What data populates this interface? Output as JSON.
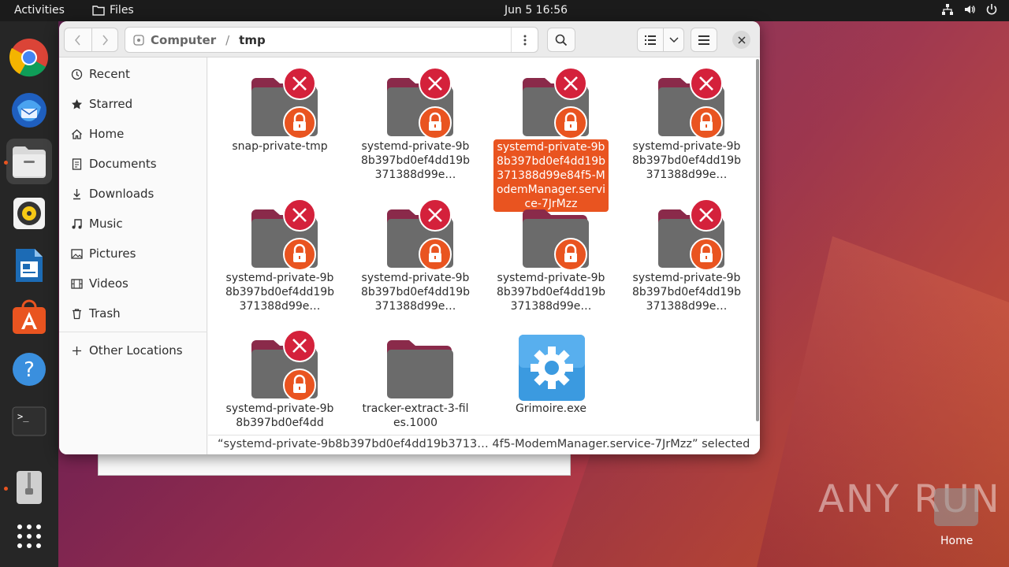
{
  "topbar": {
    "activities": "Activities",
    "app_name": "Files",
    "clock": "Jun 5  16:56"
  },
  "dock": {
    "items": [
      "chrome-icon",
      "thunderbird-icon",
      "files-icon",
      "rhythmbox-icon",
      "libreoffice-writer-icon",
      "app-center-icon",
      "help-icon",
      "terminal-icon",
      "archive-manager-icon",
      "show-apps-icon"
    ]
  },
  "window": {
    "path": {
      "root": "Computer",
      "current": "tmp"
    },
    "sidebar": {
      "items": [
        {
          "label": "Recent",
          "icon": "clock-icon"
        },
        {
          "label": "Starred",
          "icon": "star-icon"
        },
        {
          "label": "Home",
          "icon": "home-icon"
        },
        {
          "label": "Documents",
          "icon": "document-icon"
        },
        {
          "label": "Downloads",
          "icon": "download-icon"
        },
        {
          "label": "Music",
          "icon": "music-icon"
        },
        {
          "label": "Pictures",
          "icon": "picture-icon"
        },
        {
          "label": "Videos",
          "icon": "video-icon"
        },
        {
          "label": "Trash",
          "icon": "trash-icon"
        }
      ],
      "other": "Other Locations"
    },
    "files": [
      {
        "name": "snap-private-tmp",
        "type": "locked-folder"
      },
      {
        "name": "systemd-private-9b8b397bd0ef4dd19b371388d99e…",
        "type": "locked-folder"
      },
      {
        "name": "systemd-private-9b8b397bd0ef4dd19b371388d99e84f5-ModemManager.service-7JrMzz",
        "type": "locked-folder",
        "selected": true
      },
      {
        "name": "systemd-private-9b8b397bd0ef4dd19b371388d99e…",
        "type": "locked-folder"
      },
      {
        "name": "systemd-private-9b8b397bd0ef4dd19b371388d99e…",
        "type": "locked-folder"
      },
      {
        "name": "systemd-private-9b8b397bd0ef4dd19b371388d99e…",
        "type": "locked-folder"
      },
      {
        "name": "systemd-private-9b8b397bd0ef4dd19b371388d99e…",
        "type": "locked-folder"
      },
      {
        "name": "systemd-private-9b8b397bd0ef4dd19b371388d99e…",
        "type": "locked-folder"
      },
      {
        "name": "systemd-private-9b8b397bd0ef4dd",
        "type": "locked-folder"
      },
      {
        "name": "tracker-extract-3-files.1000",
        "type": "folder"
      },
      {
        "name": "Grimoire.exe",
        "type": "executable"
      }
    ],
    "status": "“systemd-private-9b8b397bd0ef4dd19b3713… 4f5-ModemManager.service-7JrMzz” selected"
  },
  "desktop": {
    "watermark": "ANY RUN",
    "home_label": "Home"
  },
  "colors": {
    "accent": "#e95420",
    "error": "#d4213b",
    "folder": "#6b6b6b",
    "folder_tab": "#8a2a4a"
  }
}
